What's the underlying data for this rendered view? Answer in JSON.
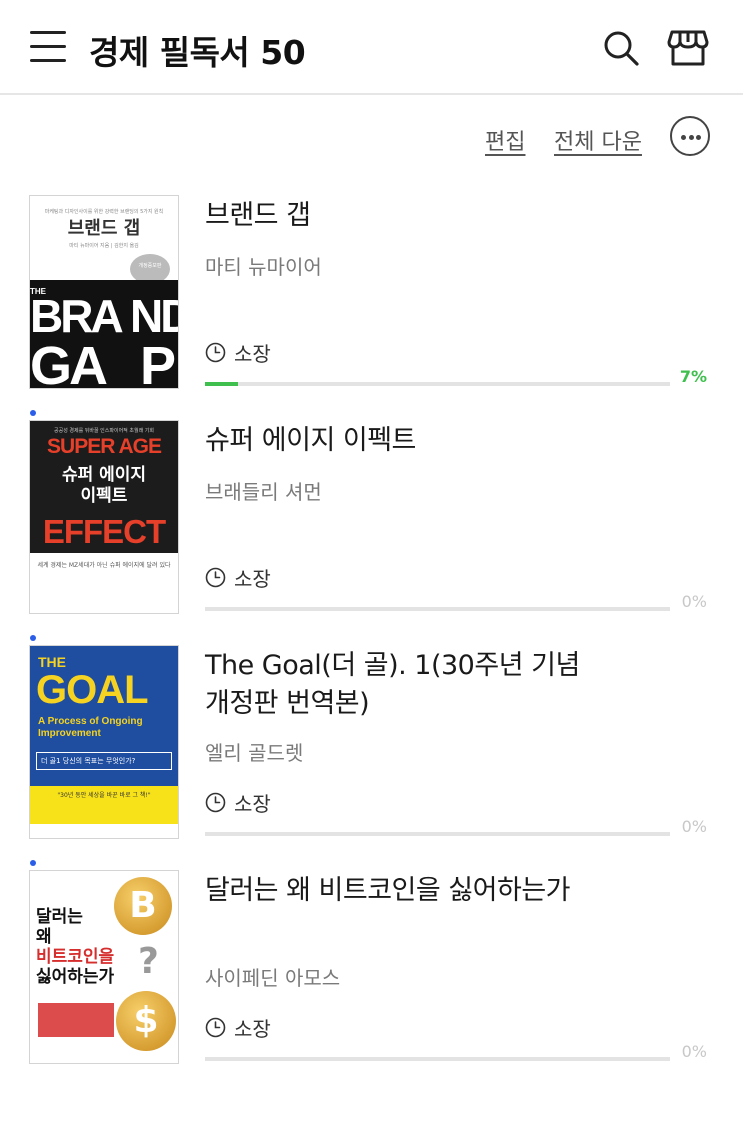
{
  "header": {
    "title": "경제 필독서 50"
  },
  "toolbar": {
    "edit_label": "편집",
    "download_all_label": "전체 다운"
  },
  "books": [
    {
      "title": "브랜드 갭",
      "author": "마티 뉴마이어",
      "status": "소장",
      "progress_percent": 7,
      "progress_label": "7%",
      "is_new": false,
      "cover": {
        "subtitle": "마케팅과 디자인사이를 위한 강력한 브랜딩의 5가지 원칙",
        "title": "브랜드 갭",
        "author": "마티 뉴마이어 지음 | 김한지 옮김",
        "badge": "개정증보판",
        "publisher": "알키",
        "en_left": "THE BRA GA",
        "en_right": "ND P"
      }
    },
    {
      "title": "슈퍼 에이지 이펙트",
      "author": "브래들리 셔먼",
      "status": "소장",
      "progress_percent": 0,
      "progress_label": "0%",
      "is_new": true,
      "cover": {
        "tagline": "공공성 경제를 뒤바꿀 인스파이어적 초월래 기회",
        "top": "SUPER AGE",
        "title_line1": "슈퍼 에이지",
        "title_line2": "이펙트",
        "bottom": "EFFECT",
        "blurb": "세계 경제는 MZ세대가 아닌 슈퍼 에이지에 달려 있다"
      }
    },
    {
      "title": "The Goal(더 골). 1(30주년 기념 개정판 번역본)",
      "author": "엘리 골드렛",
      "status": "소장",
      "progress_percent": 0,
      "progress_label": "0%",
      "is_new": true,
      "cover": {
        "the": "THE",
        "goal": "GOAL",
        "subtitle_line1": "A Process of Ongoing",
        "subtitle_line2": "Improvement",
        "band": "더 골1  당신의 목표는 무엇인가?",
        "quote": "\"30년 동안 세상을 바꾼 바로 그 책!\""
      }
    },
    {
      "title": "달러는 왜 비트코인을 싫어하는가",
      "author": "사이페딘 아모스",
      "status": "소장",
      "progress_percent": 0,
      "progress_label": "0%",
      "is_new": true,
      "cover": {
        "line1": "달러는",
        "line2": "왜",
        "line3": "비트코인을",
        "line4": "싫어하는가",
        "coin1": "B",
        "coin2": "$",
        "q": "?"
      }
    }
  ],
  "colors": {
    "progress_active": "#3fbf4d",
    "new_dot": "#2b5ee8"
  }
}
